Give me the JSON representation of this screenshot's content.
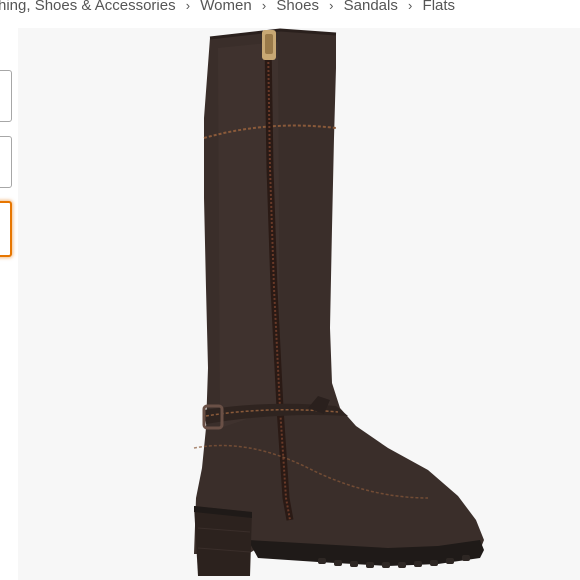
{
  "breadcrumb": {
    "items": [
      "hing, Shoes & Accessories",
      "Women",
      "Shoes",
      "Sandals",
      "Flats"
    ],
    "separator": "›"
  },
  "thumbnails": {
    "count": 3,
    "selected_index": 2
  },
  "product_image": {
    "subject": "boot-image",
    "colors": {
      "leather": "#3a2e2a",
      "leather_dark": "#2a201d",
      "stitch": "#8a5a3a",
      "zipper": "#c8a874",
      "sole": "#1f1a18",
      "heel": "#2c221e"
    }
  }
}
